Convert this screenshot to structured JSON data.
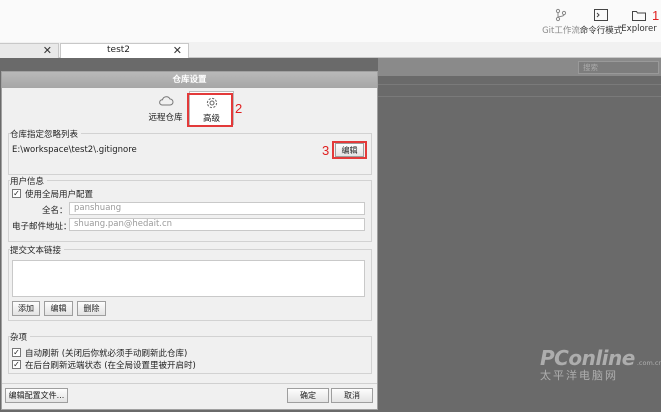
{
  "toolbar": {
    "git_workflow": "Git工作流",
    "terminal": "命令行模式",
    "explorer": "Explorer",
    "explorer_mark": "1"
  },
  "tabs": [
    {
      "label": ""
    },
    {
      "label": "test2"
    }
  ],
  "search": {
    "placeholder": "搜索"
  },
  "dialog": {
    "title": "仓库设置",
    "tabs": {
      "remote": "远程仓库",
      "advanced": "高级"
    },
    "advanced_mark": "2",
    "ignore": {
      "title": "仓库指定忽略列表",
      "path": "E:\\workspace\\test2\\.gitignore",
      "edit_label": "编辑",
      "edit_mark": "3"
    },
    "user": {
      "title": "用户信息",
      "use_global_label": "使用全局用户配置",
      "use_global_checked": true,
      "name_label": "全名：",
      "name_value": "panshuang",
      "email_label": "电子邮件地址：",
      "email_value": "shuang.pan@hedait.cn"
    },
    "commit_links": {
      "title": "提交文本链接",
      "add_label": "添加",
      "edit_label": "编辑",
      "delete_label": "删除"
    },
    "misc": {
      "title": "杂项",
      "auto_refresh_label": "自动刷新 (关闭后你就必须手动刷新此仓库)",
      "auto_refresh_checked": true,
      "bg_refresh_label": "在后台刷新远端状态 (在全局设置里被开启时)",
      "bg_refresh_checked": true
    },
    "footer": {
      "edit_config_label": "编辑配置文件...",
      "ok_label": "确定",
      "cancel_label": "取消"
    }
  },
  "watermark": {
    "brand": "PConline",
    "domain": ".com.cn",
    "chinese": "太平洋电脑网"
  }
}
